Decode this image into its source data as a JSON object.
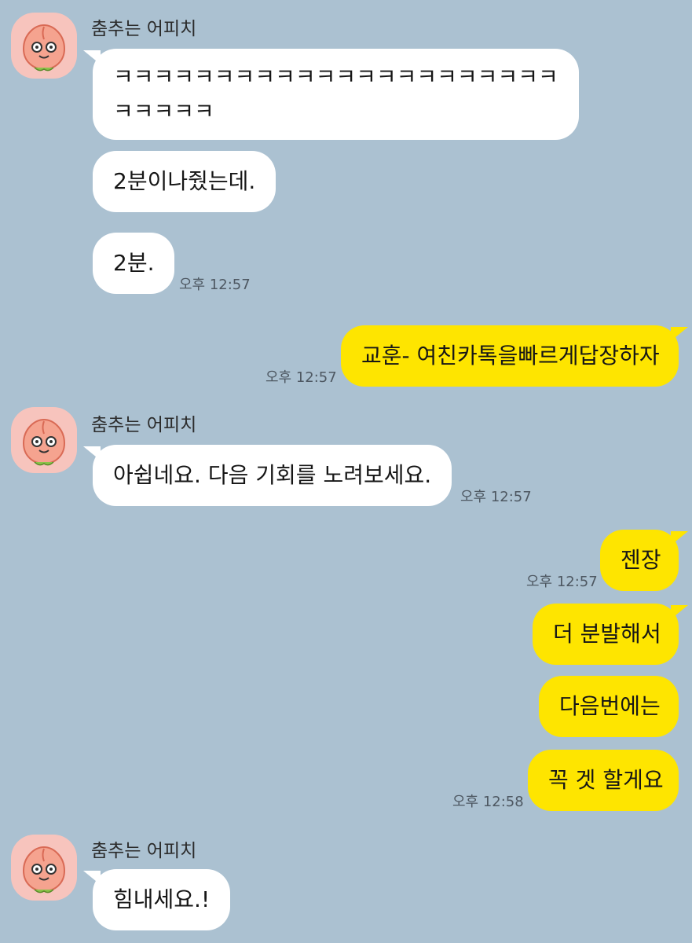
{
  "colors": {
    "background": "#abc1d1",
    "incoming_bubble": "#ffffff",
    "outgoing_bubble": "#fee500",
    "avatar_background": "#f7c4bd"
  },
  "sender_name": "춤추는 어피치",
  "avatar_icon": "apeach-character-icon",
  "messages": {
    "m1_line1": "ㅋㅋㅋㅋㅋㅋㅋㅋㅋㅋㅋㅋㅋㅋㅋㅋㅋㅋㅋㅋㅋㅋ",
    "m1_line2": "ㅋㅋㅋㅋㅋ",
    "m2": "2분이나줬는데.",
    "m3": "2분.",
    "m4": "교훈- 여친카톡을빠르게답장하자",
    "m5": "아쉽네요. 다음 기회를 노려보세요.",
    "m6": "젠장",
    "m7": "더 분발해서",
    "m8": "다음번에는",
    "m9": "꼭 겟 할게요",
    "m10": "힘내세요.!"
  },
  "times": {
    "t1": "오후 12:57",
    "t2": "오후 12:57",
    "t3": "오후 12:57",
    "t4": "오후 12:57",
    "t5": "오후 12:58"
  }
}
